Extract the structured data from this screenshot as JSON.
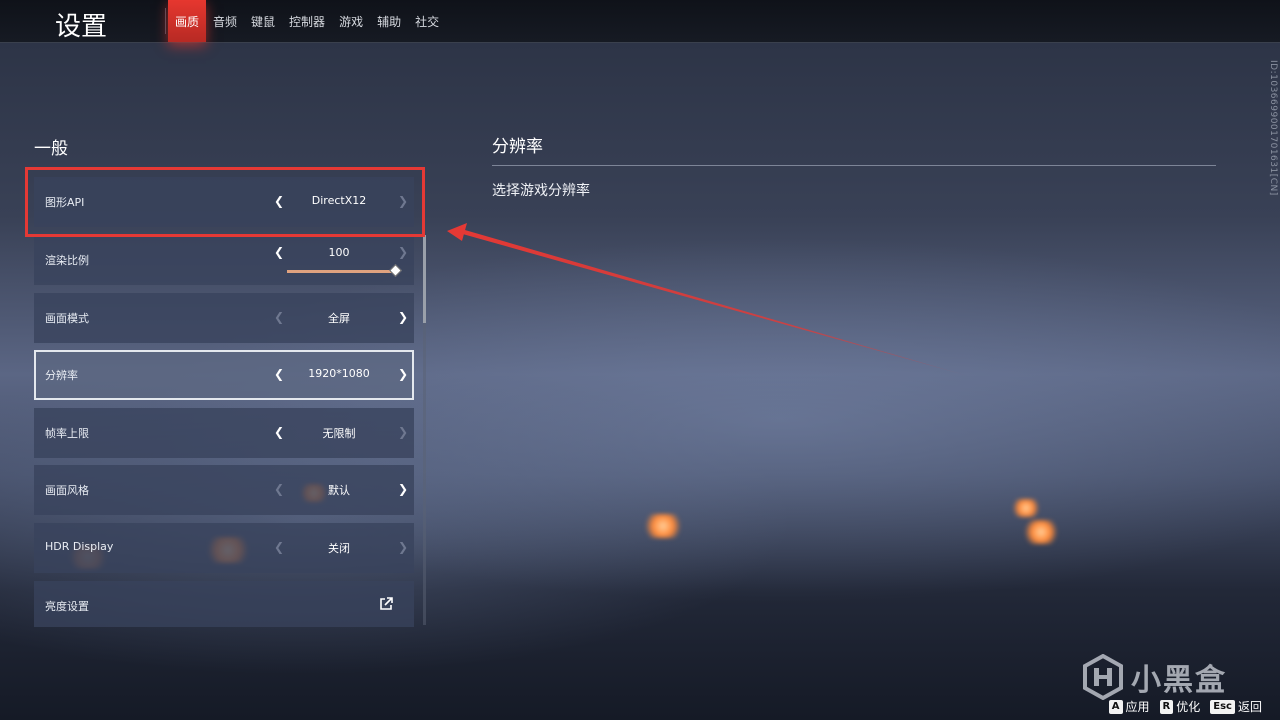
{
  "header": {
    "title": "设置",
    "tabs": [
      "画质",
      "音频",
      "键鼠",
      "控制器",
      "游戏",
      "辅助",
      "社交"
    ],
    "active_tab": "画质",
    "accent_color": "#e6372f"
  },
  "side_id": "ID:1036699001701631[CN]",
  "section": {
    "title": "一般"
  },
  "settings": [
    {
      "label": "图形API",
      "value": "DirectX12",
      "left_enabled": true,
      "right_enabled": false
    },
    {
      "label": "渲染比例",
      "value": "100",
      "left_enabled": true,
      "right_enabled": false,
      "slider_fraction": 1.0
    },
    {
      "label": "画面模式",
      "value": "全屏",
      "left_enabled": false,
      "right_enabled": true
    },
    {
      "label": "分辨率",
      "value": "1920*1080",
      "left_enabled": true,
      "right_enabled": true,
      "selected": true
    },
    {
      "label": "帧率上限",
      "value": "无限制",
      "left_enabled": true,
      "right_enabled": false
    },
    {
      "label": "画面风格",
      "value": "默认",
      "left_enabled": false,
      "right_enabled": true
    },
    {
      "label": "HDR Display",
      "value": "关闭",
      "left_enabled": false,
      "right_enabled": false
    },
    {
      "label": "亮度设置",
      "value": "",
      "icon": "external-link-icon"
    }
  ],
  "detail": {
    "title": "分辨率",
    "description": "选择游戏分辨率"
  },
  "annotation": {
    "color": "#e53935"
  },
  "watermark": {
    "text": "小黑盒"
  },
  "hints": [
    {
      "key": "A",
      "label": "应用"
    },
    {
      "key": "R",
      "label": "优化"
    },
    {
      "key": "Esc",
      "label": "返回"
    }
  ]
}
